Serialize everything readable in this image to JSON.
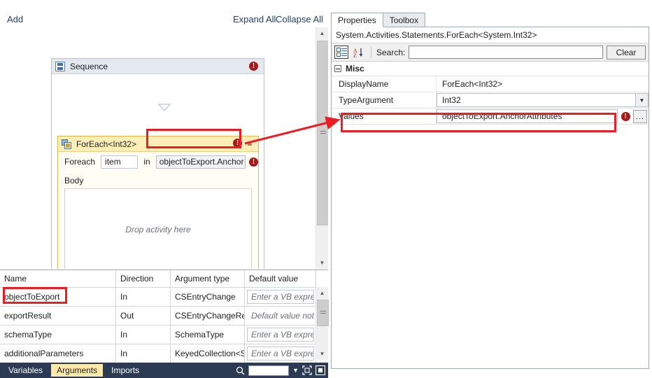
{
  "designer": {
    "toolbar": {
      "add_label": "Add",
      "expand_all_label": "Expand All",
      "collapse_all_label": "Collapse All"
    },
    "sequence": {
      "title": "Sequence",
      "icon": "sequence-icon",
      "error_icon": "error-icon"
    },
    "foreach": {
      "title": "ForEach<Int32>",
      "icon": "foreach-icon",
      "error_icon": "error-icon",
      "collapse_icon": "chevron-up-icon",
      "foreach_label": "Foreach",
      "item_value": "item",
      "in_label": "in",
      "values_expression": "objectToExport.Anchor",
      "values_error_icon": "error-icon",
      "body_label": "Body",
      "dropzone_text": "Drop activity here"
    },
    "scrollbar": {
      "up_icon": "chevron-up-icon",
      "down_icon": "chevron-down-icon",
      "thumb_grip_icon": "grip-icon"
    }
  },
  "arguments_grid": {
    "columns": [
      "Name",
      "Direction",
      "Argument type",
      "Default value"
    ],
    "rows": [
      {
        "name": "objectToExport",
        "direction": "In",
        "type": "CSEntryChange",
        "default_value": "Enter a VB express",
        "default_boxed": true
      },
      {
        "name": "exportResult",
        "direction": "Out",
        "type": "CSEntryChangeRes",
        "default_value": "Default value not su",
        "default_boxed": false
      },
      {
        "name": "schemaType",
        "direction": "In",
        "type": "SchemaType",
        "default_value": "Enter a VB express",
        "default_boxed": true
      },
      {
        "name": "additionalParameters",
        "direction": "In",
        "type": "KeyedCollection<S",
        "default_value": "Enter a VB express",
        "default_boxed": true
      }
    ],
    "scrollbar": {
      "up_icon": "chevron-up-icon",
      "down_icon": "chevron-down-icon",
      "thumb_grip_icon": "grip-icon"
    }
  },
  "status_bar": {
    "tabs": [
      {
        "label": "Variables",
        "active": false
      },
      {
        "label": "Arguments",
        "active": true
      },
      {
        "label": "Imports",
        "active": false
      }
    ],
    "search_icon": "search-icon",
    "zoom_value": "",
    "zoom_caret_icon": "chevron-down-icon",
    "fit_to_screen_icon": "fit-to-screen-icon",
    "overview_map_icon": "overview-map-icon",
    "accent_color": "#2d3a53",
    "active_tab_color": "#fde9a8"
  },
  "properties": {
    "tabs": [
      {
        "label": "Properties",
        "active": true
      },
      {
        "label": "Toolbox",
        "active": false
      }
    ],
    "selected_type": "System.Activities.Statements.ForEach<System.Int32>",
    "toolbar": {
      "categorized_icon": "categorized-view-icon",
      "alphabetical_icon": "alphabetical-sort-icon",
      "search_label": "Search:",
      "search_value": "",
      "clear_label": "Clear"
    },
    "groups": [
      {
        "name": "Misc",
        "collapse_icon": "minus-box-icon",
        "rows": [
          {
            "name": "DisplayName",
            "value": "ForEach<Int32>",
            "style": "plain"
          },
          {
            "name": "TypeArgument",
            "value": "Int32",
            "style": "combo",
            "caret_icon": "chevron-down-icon"
          },
          {
            "name": "Values",
            "value": "objectToExport.AnchorAttributes",
            "style": "expression",
            "error_icon": "error-icon",
            "ellipsis_label": "...",
            "highlighted": true
          }
        ]
      }
    ]
  },
  "annotations": {
    "highlight_color": "#ee1c25",
    "arrow_from": "foreach-values-field",
    "arrow_to": "properties-values-row"
  }
}
